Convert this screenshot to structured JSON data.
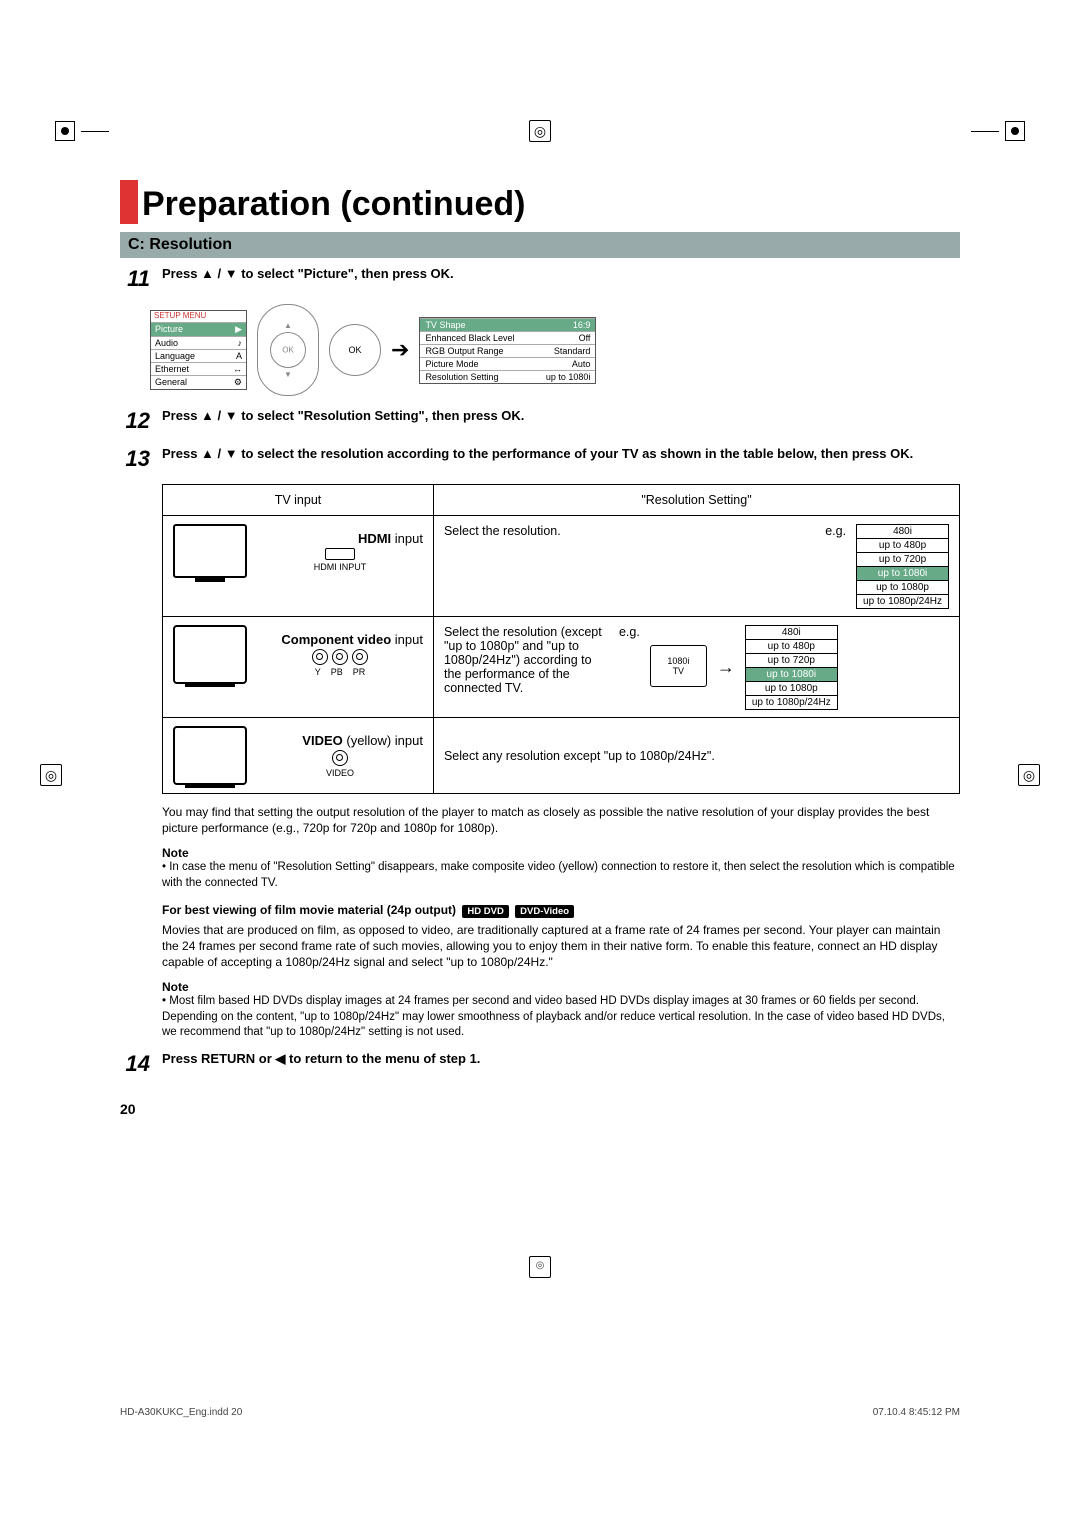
{
  "title": "Preparation (continued)",
  "section": "C: Resolution",
  "steps": {
    "s11": {
      "num": "11",
      "text": "Press ▲ / ▼ to select \"Picture\", then press OK."
    },
    "s12": {
      "num": "12",
      "text": "Press ▲ / ▼ to select \"Resolution Setting\", then press OK."
    },
    "s13": {
      "num": "13",
      "text": "Press ▲ / ▼ to select the resolution according to the performance of your TV as shown in the table below, then press OK."
    },
    "s14": {
      "num": "14",
      "text": "Press RETURN or ◀ to return to the menu of step 1."
    }
  },
  "setup_menu": {
    "label": "SETUP MENU",
    "items": [
      "Picture",
      "Audio",
      "Language",
      "Ethernet",
      "General"
    ],
    "selected": "Picture"
  },
  "picture_menu": {
    "rows": [
      {
        "l": "TV Shape",
        "r": "16:9"
      },
      {
        "l": "Enhanced Black Level",
        "r": "Off"
      },
      {
        "l": "RGB Output Range",
        "r": "Standard"
      },
      {
        "l": "Picture Mode",
        "r": "Auto"
      },
      {
        "l": "Resolution Setting",
        "r": "up to 1080i"
      }
    ],
    "selected_row": 0
  },
  "table": {
    "head": {
      "c1": "TV input",
      "c2": "\"Resolution Setting\""
    },
    "row1": {
      "label_html_pre": "HDMI",
      "label_post": " input",
      "conn": "HDMI INPUT",
      "right_a": "Select the resolution.",
      "eg": "e.g.",
      "options": [
        "480i",
        "up to 480p",
        "up to 720p",
        "up to 1080i",
        "up to 1080p",
        "up to 1080p/24Hz"
      ],
      "selected": "up to 1080i"
    },
    "row2": {
      "label_html_pre": "Component video",
      "label_post": " input",
      "conn_ypbpr": {
        "y": "Y",
        "pb": "PB",
        "pr": "PR"
      },
      "right_text": "Select the resolution (except \"up to 1080p\" and \"up to 1080p/24Hz\") according to the performance of the connected TV.",
      "eg": "e.g.",
      "mini_tv_top": "1080i",
      "mini_tv_bot": "TV",
      "options": [
        "480i",
        "up to 480p",
        "up to 720p",
        "up to 1080i",
        "up to 1080p",
        "up to 1080p/24Hz"
      ],
      "selected": "up to 1080i"
    },
    "row3": {
      "label_pre": "VIDEO",
      "label_post": " (yellow) input",
      "conn": "VIDEO",
      "right_text": "Select any resolution except \"up to 1080p/24Hz\"."
    }
  },
  "paragraphs": {
    "after_table": "You may find that setting the output resolution of the player to match as closely as possible the native resolution of your display provides the best picture performance (e.g., 720p for 720p and 1080p for 1080p).",
    "note1_h": "Note",
    "note1": "In case the menu of \"Resolution Setting\" disappears, make composite video (yellow) connection to restore it, then select the resolution which is compatible with the connected TV.",
    "film_h": "For best viewing of film movie material (24p output)",
    "badge1": "HD DVD",
    "badge2": "DVD-Video",
    "film_p": "Movies that are produced on film, as opposed to video, are traditionally captured at a frame rate of 24 frames per second. Your player can maintain the 24 frames per second frame rate of such movies, allowing you to enjoy them in their native form. To enable this feature, connect an HD display capable of accepting a 1080p/24Hz signal and select \"up to 1080p/24Hz.\"",
    "note2_h": "Note",
    "note2": "Most film based HD DVDs display images at 24 frames per second and video based HD DVDs display images at 30 frames or 60 fields per second. Depending on the content, \"up to 1080p/24Hz\" may lower smoothness of playback and/or reduce vertical resolution. In the case of video based HD DVDs, we recommend that \"up to 1080p/24Hz\" setting is not used."
  },
  "page_number": "20",
  "footer": {
    "left": "HD-A30KUKC_Eng.indd   20",
    "right": "07.10.4   8:45:12 PM"
  }
}
